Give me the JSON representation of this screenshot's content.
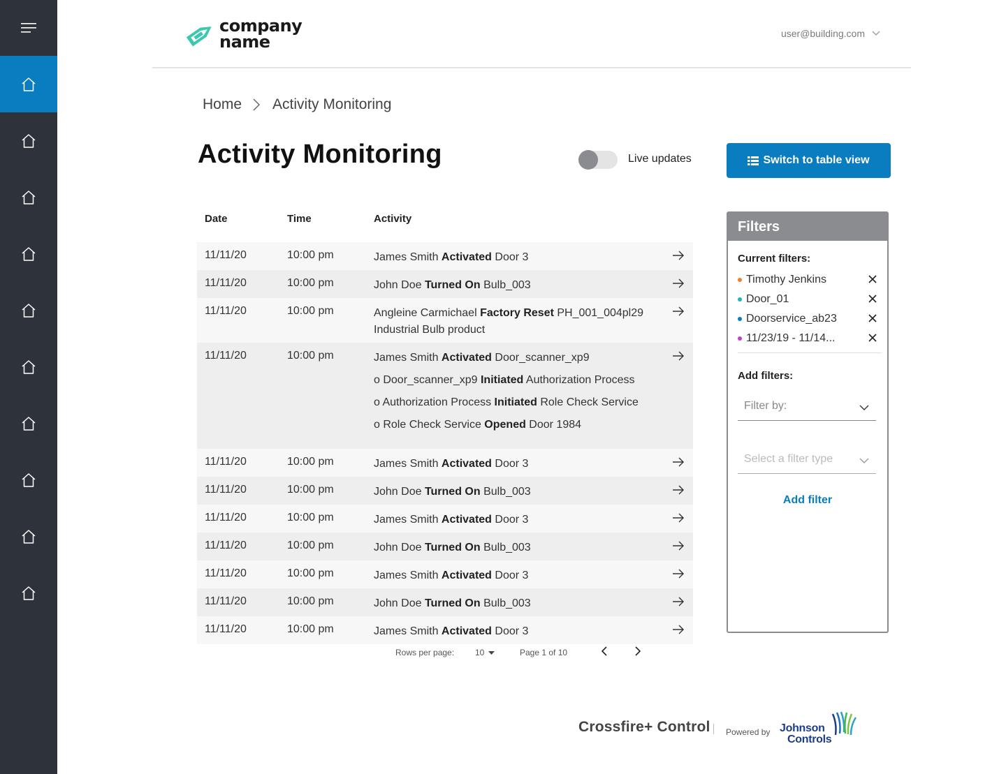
{
  "app": {
    "logo_text_line1": "company",
    "logo_text_line2": "name",
    "user_email": "user@building.com"
  },
  "colors": {
    "accent": "#0a7dc1",
    "sidebar_bg": "#2e323b",
    "filter_dot_orange": "#f07f2d",
    "filter_dot_teal": "#20b4b4",
    "filter_dot_blue": "#0a7dc1",
    "filter_dot_magenta": "#c33fcf"
  },
  "sidebar": {
    "menu_icon": "hamburger-menu-icon",
    "items": [
      {
        "icon": "home-icon",
        "active": true
      },
      {
        "icon": "home-icon",
        "active": false
      },
      {
        "icon": "home-icon",
        "active": false
      },
      {
        "icon": "home-icon",
        "active": false
      },
      {
        "icon": "home-icon",
        "active": false
      },
      {
        "icon": "home-icon",
        "active": false
      },
      {
        "icon": "home-icon",
        "active": false
      },
      {
        "icon": "home-icon",
        "active": false
      },
      {
        "icon": "home-icon",
        "active": false
      },
      {
        "icon": "home-icon",
        "active": false
      }
    ]
  },
  "breadcrumb": {
    "home": "Home",
    "current": "Activity Monitoring"
  },
  "page": {
    "title": "Activity Monitoring",
    "live_updates_label": "Live updates",
    "live_updates_on": false,
    "table_view_button": "Switch to table view"
  },
  "table": {
    "headers": {
      "date": "Date",
      "time": "Time",
      "activity": "Activity"
    },
    "rows": [
      {
        "date": "11/11/20",
        "time": "10:00 pm",
        "parts": [
          [
            "James Smith ",
            false
          ],
          [
            "Activated",
            true
          ],
          [
            " Door 3",
            false
          ]
        ],
        "sub": []
      },
      {
        "date": "11/11/20",
        "time": "10:00 pm",
        "parts": [
          [
            "John Doe ",
            false
          ],
          [
            "Turned On",
            true
          ],
          [
            " Bulb_003",
            false
          ]
        ],
        "sub": []
      },
      {
        "date": "11/11/20",
        "time": "10:00 pm",
        "parts": [
          [
            "Angleine Carmichael ",
            false
          ],
          [
            "Factory Reset",
            true
          ],
          [
            " PH_001_004pl29 Industrial Bulb product",
            false
          ]
        ],
        "sub": []
      },
      {
        "date": "11/11/20",
        "time": "10:00 pm",
        "parts": [
          [
            "James Smith ",
            false
          ],
          [
            "Activated",
            true
          ],
          [
            " Door_scanner_xp9",
            false
          ]
        ],
        "sub": [
          [
            [
              "o Door_scanner_xp9 ",
              false
            ],
            [
              "Initiated",
              true
            ],
            [
              " Authorization Process",
              false
            ]
          ],
          [
            [
              "o Authorization Process ",
              false
            ],
            [
              "Initiated",
              true
            ],
            [
              " Role Check Service",
              false
            ]
          ],
          [
            [
              "o Role Check Service ",
              false
            ],
            [
              "Opened",
              true
            ],
            [
              " Door 1984",
              false
            ]
          ]
        ]
      },
      {
        "date": "11/11/20",
        "time": "10:00 pm",
        "parts": [
          [
            "James Smith ",
            false
          ],
          [
            "Activated",
            true
          ],
          [
            " Door 3",
            false
          ]
        ],
        "sub": []
      },
      {
        "date": "11/11/20",
        "time": "10:00 pm",
        "parts": [
          [
            "John Doe ",
            false
          ],
          [
            "Turned On",
            true
          ],
          [
            " Bulb_003",
            false
          ]
        ],
        "sub": []
      },
      {
        "date": "11/11/20",
        "time": "10:00 pm",
        "parts": [
          [
            "James Smith ",
            false
          ],
          [
            "Activated",
            true
          ],
          [
            " Door 3",
            false
          ]
        ],
        "sub": []
      },
      {
        "date": "11/11/20",
        "time": "10:00 pm",
        "parts": [
          [
            "John Doe ",
            false
          ],
          [
            "Turned On",
            true
          ],
          [
            " Bulb_003",
            false
          ]
        ],
        "sub": []
      },
      {
        "date": "11/11/20",
        "time": "10:00 pm",
        "parts": [
          [
            "James Smith ",
            false
          ],
          [
            "Activated",
            true
          ],
          [
            " Door 3",
            false
          ]
        ],
        "sub": []
      },
      {
        "date": "11/11/20",
        "time": "10:00 pm",
        "parts": [
          [
            "John Doe ",
            false
          ],
          [
            "Turned On",
            true
          ],
          [
            " Bulb_003",
            false
          ]
        ],
        "sub": []
      },
      {
        "date": "11/11/20",
        "time": "10:00 pm",
        "parts": [
          [
            "James Smith ",
            false
          ],
          [
            "Activated",
            true
          ],
          [
            " Door 3",
            false
          ]
        ],
        "sub": []
      }
    ]
  },
  "pagination": {
    "rows_per_page_label": "Rows per page:",
    "rows_per_page_value": "10",
    "page_info": "Page 1 of 10"
  },
  "filters": {
    "title": "Filters",
    "current_label": "Current filters:",
    "current": [
      {
        "name": "Timothy Jenkins",
        "color": "#f07f2d"
      },
      {
        "name": "Door_01",
        "color": "#20b4b4"
      },
      {
        "name": "Doorservice_ab23",
        "color": "#0a7dc1"
      },
      {
        "name": "11/23/19 - 11/14...",
        "color": "#c33fcf"
      }
    ],
    "add_label": "Add filters:",
    "filter_by_placeholder": "Filter by:",
    "filter_type_placeholder": "Select a filter type",
    "add_button": "Add filter"
  },
  "footer": {
    "product": "Crossfire+ Control",
    "powered_by": "Powered by",
    "brand_line1": "Johnson",
    "brand_line2": "Controls"
  }
}
